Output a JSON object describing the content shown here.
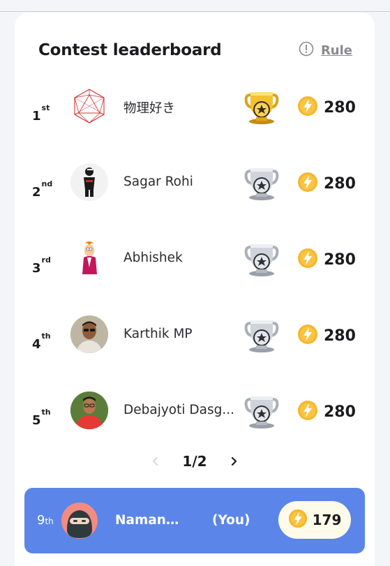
{
  "header": {
    "title": "Contest leaderboard",
    "rule_label": "Rule"
  },
  "rows": [
    {
      "rank": "1",
      "suffix": "st",
      "name": "物理好き",
      "score": "280",
      "trophy": "gold-trophy-icon",
      "avatar": "icosahedron-avatar"
    },
    {
      "rank": "2",
      "suffix": "nd",
      "name": "Sagar Rohi",
      "score": "280",
      "trophy": "silver-trophy-icon",
      "avatar": "ninja-figure-avatar"
    },
    {
      "rank": "3",
      "suffix": "rd",
      "name": "Abhishek",
      "score": "280",
      "trophy": "silver-trophy-icon",
      "avatar": "cartoon-character-avatar"
    },
    {
      "rank": "4",
      "suffix": "th",
      "name": "Karthik MP",
      "score": "280",
      "trophy": "silver-trophy-icon",
      "avatar": "user-photo-avatar"
    },
    {
      "rank": "5",
      "suffix": "th",
      "name": "Debajyoti Dasg...",
      "score": "280",
      "trophy": "silver-trophy-icon",
      "avatar": "user-photo-avatar"
    }
  ],
  "pagination": {
    "label": "1/2"
  },
  "me": {
    "rank": "9",
    "suffix": "th",
    "name": "Naman...",
    "you_label": "(You)",
    "score": "179"
  },
  "colors": {
    "accent": "#5b85e8",
    "coin": "#f6b62c",
    "gold": "#e9b723",
    "silver": "#b7bcc6"
  }
}
